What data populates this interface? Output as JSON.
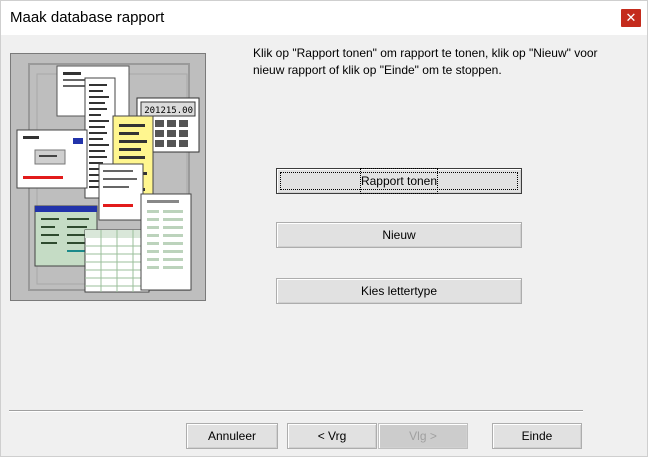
{
  "window": {
    "title": "Maak database rapport",
    "close_glyph": "✕"
  },
  "illustration": {
    "calculator_display": "201215.00"
  },
  "instructions": {
    "text": "Klik op \"Rapport tonen\" om rapport te tonen, klik op \"Nieuw\" voor nieuw rapport of klik op \"Einde\" om te stoppen."
  },
  "actions": {
    "show_report": "Rapport tonen",
    "new": "Nieuw",
    "choose_font": "Kies lettertype"
  },
  "footer": {
    "cancel": "Annuleer",
    "back": "< Vrg",
    "next": "Vlg >",
    "finish": "Einde"
  },
  "colors": {
    "close_button": "#c42b1c",
    "dialog_background": "#f0f0f0",
    "illustration_background": "#bebebe",
    "yellow_sheet": "#fff68f",
    "green_sheet": "#c5dcc5",
    "red_accent": "#e21b1b",
    "blue_accent": "#2233aa"
  }
}
